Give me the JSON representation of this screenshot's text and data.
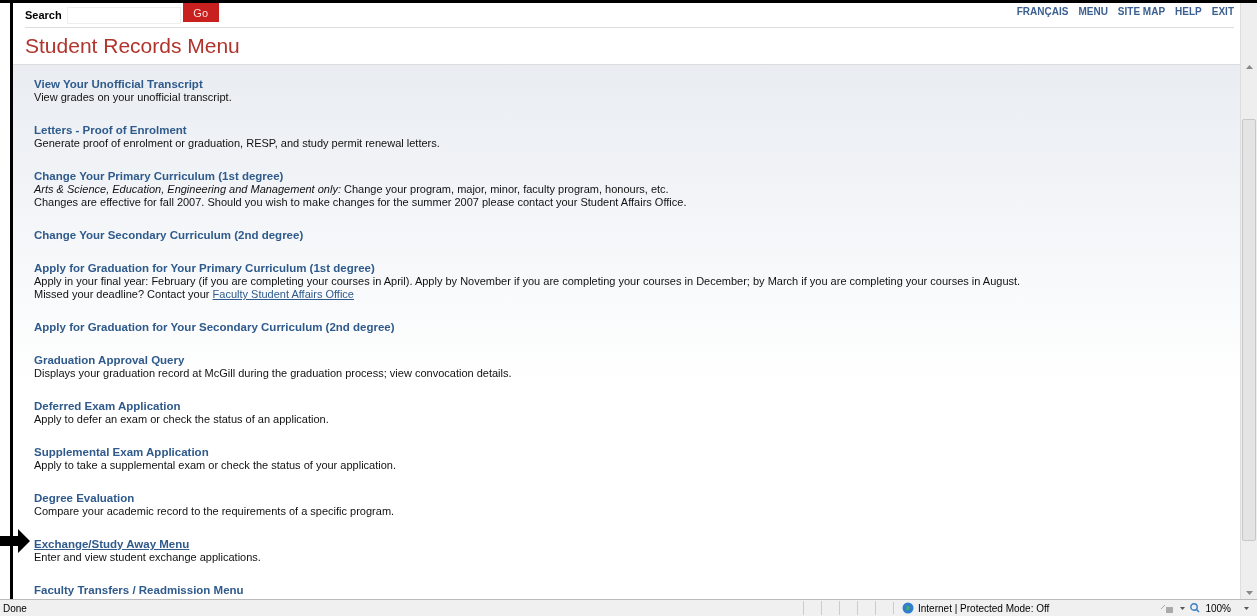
{
  "search": {
    "label": "Search",
    "button": "Go"
  },
  "nav": [
    "FRANÇAIS",
    "MENU",
    "SITE MAP",
    "HELP",
    "EXIT"
  ],
  "title": "Student Records Menu",
  "items": [
    {
      "title": "View Your Unofficial Transcript",
      "underlined": false,
      "lines": [
        {
          "text": "View grades on your unofficial transcript."
        }
      ]
    },
    {
      "title": "Letters - Proof of Enrolment",
      "underlined": false,
      "lines": [
        {
          "text": "Generate proof of enrolment or graduation, RESP, and study permit renewal letters."
        }
      ]
    },
    {
      "title": "Change Your Primary Curriculum (1st degree)",
      "underlined": false,
      "lines": [
        {
          "text": "*Arts & Science, Education, Engineering and Management only:* Change your program, major, minor, faculty program, honours, etc."
        },
        {
          "text": "Changes are effective for fall 2007. Should you wish to make changes for the summer 2007 please contact your Student Affairs Office."
        }
      ]
    },
    {
      "title": "Change Your Secondary Curriculum (2nd degree)",
      "underlined": false
    },
    {
      "title": "Apply for Graduation for Your Primary Curriculum (1st degree)",
      "underlined": false,
      "lines": [
        {
          "text": "Apply in your final year: February (if you are completing your courses in April). Apply by November if you are completing your courses in December; by March if you are completing your courses in August."
        },
        {
          "text": "Missed your deadline? Contact your",
          "link": "Faculty Student Affairs Office"
        }
      ]
    },
    {
      "title": "Apply for Graduation for Your Secondary Curriculum (2nd degree)",
      "underlined": false
    },
    {
      "title": "Graduation Approval Query",
      "underlined": false,
      "lines": [
        {
          "text": "Displays your graduation record at McGill during the graduation process; view convocation details."
        }
      ]
    },
    {
      "title": "Deferred Exam Application",
      "underlined": false,
      "lines": [
        {
          "text": "Apply to defer an exam or check the status of an application."
        }
      ]
    },
    {
      "title": "Supplemental Exam Application",
      "underlined": false,
      "lines": [
        {
          "text": "Apply to take a supplemental exam or check the status of your application."
        }
      ]
    },
    {
      "title": "Degree Evaluation",
      "underlined": false,
      "lines": [
        {
          "text": "Compare your academic record to the requirements of a specific program."
        }
      ]
    },
    {
      "title": "Exchange/Study Away Menu",
      "underlined": true,
      "lines": [
        {
          "text": "Enter and view student exchange applications."
        }
      ]
    },
    {
      "title": "Faculty Transfers / Readmission Menu",
      "underlined": false
    }
  ],
  "status": {
    "text": "Done",
    "zone": "Internet | Protected Mode: Off",
    "zoom": "100%"
  }
}
